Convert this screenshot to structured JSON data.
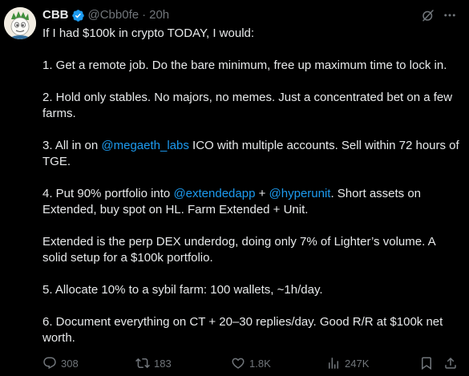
{
  "tweet": {
    "author": {
      "name": "CBB",
      "handle": "@Cbb0fe",
      "separator": "·",
      "time": "20h",
      "verified_color": "#1d9bf0",
      "avatar_icon": "cartoon-character-avatar"
    },
    "body": {
      "intro": "If I had $100k in crypto TODAY, I would:",
      "p1": "1. Get a remote job. Do the bare minimum, free up maximum time to lock in.",
      "p2": "2. Hold only stables. No majors, no memes. Just a concentrated bet on a few farms.",
      "p3_a": "3. All in on ",
      "p3_mention": "@megaeth_labs",
      "p3_b": " ICO with multiple accounts. Sell within 72 hours of TGE.",
      "p4_a": "4. Put 90% portfolio into ",
      "p4_mention1": "@extendedapp",
      "p4_mid": " + ",
      "p4_mention2": "@hyperunit",
      "p4_b": ". Short assets on Extended, buy spot on HL. Farm Extended + Unit.",
      "p5": "Extended is the perp DEX underdog, doing only 7% of Lighter’s volume. A solid setup for a $100k portfolio.",
      "p6": "5. Allocate 10% to a sybil farm: 100 wallets, ~1h/day.",
      "p7": "6. Document everything on CT + 20–30 replies/day. Good R/R at $100k net worth."
    },
    "stats": {
      "replies": "308",
      "reposts": "183",
      "likes": "1.8K",
      "views": "247K"
    },
    "colors": {
      "text": "#e7e9ea",
      "muted": "#71767b",
      "link": "#1d9bf0",
      "background": "#000000"
    }
  }
}
